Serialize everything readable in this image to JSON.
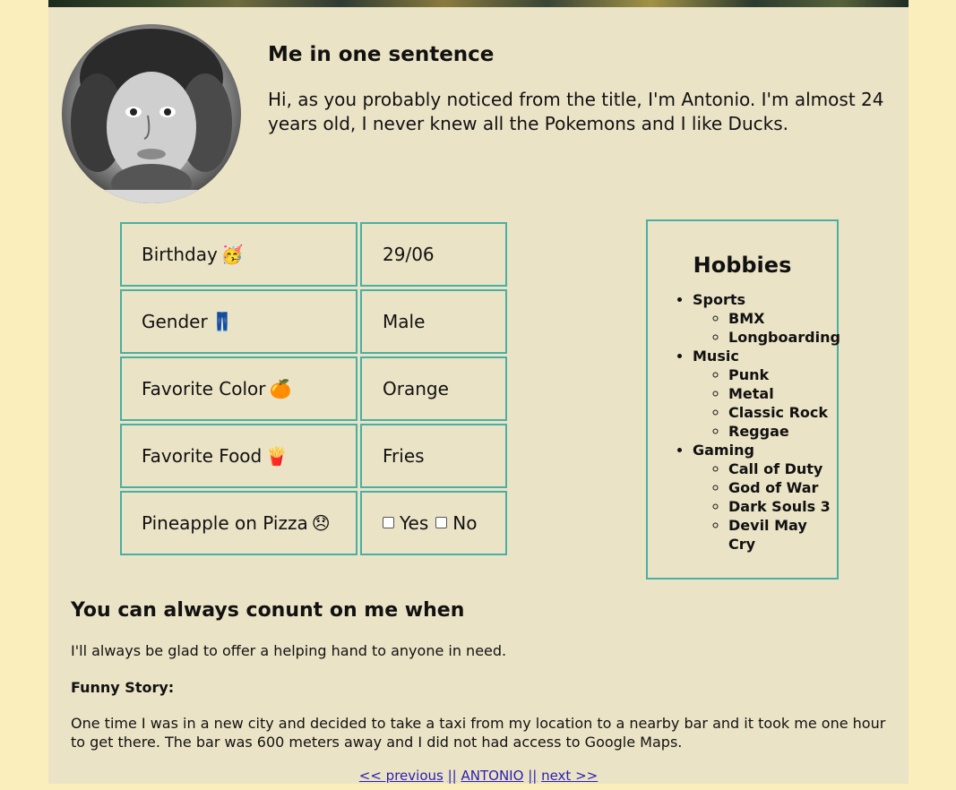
{
  "intro": {
    "title": "Me in one sentence",
    "text": "Hi, as you probably noticed from the title, I'm Antonio. I'm almost 24 years old, I never knew all the Pokemons and I like Ducks."
  },
  "info": {
    "rows": [
      {
        "label": "Birthday",
        "emoji": "🥳",
        "value": "29/06"
      },
      {
        "label": "Gender",
        "emoji": "👖",
        "value": "Male"
      },
      {
        "label": "Favorite Color",
        "emoji": "🍊",
        "value": "Orange"
      },
      {
        "label": "Favorite Food",
        "emoji": "🍟",
        "value": "Fries"
      }
    ],
    "pineapple": {
      "label": "Pineapple on Pizza",
      "emoji": "😞",
      "yes_label": "Yes",
      "no_label": "No"
    }
  },
  "hobbies": {
    "title": "Hobbies",
    "sports": {
      "label": "Sports",
      "items": [
        "BMX",
        "Longboarding"
      ]
    },
    "music": {
      "label": "Music",
      "items": [
        "Punk",
        "Metal",
        "Classic Rock",
        "Reggae"
      ]
    },
    "gaming": {
      "label": "Gaming",
      "items": [
        "Call of Duty",
        "God of War",
        "Dark Souls 3",
        "Devil May Cry"
      ]
    }
  },
  "count_on": {
    "title": "You can always conunt on me when",
    "text": "I'll always be glad to offer a helping hand to anyone in need."
  },
  "funny": {
    "label": "Funny Story:",
    "text": "One time I was in a new city and decided to take a taxi from my location to a nearby bar and it took me one hour to get there. The bar was 600 meters away and I did not had access to Google Maps."
  },
  "nav": {
    "previous": "<< previous",
    "sep1": "||",
    "name": "ANTONIO",
    "sep2": "||",
    "next": "next >>"
  }
}
